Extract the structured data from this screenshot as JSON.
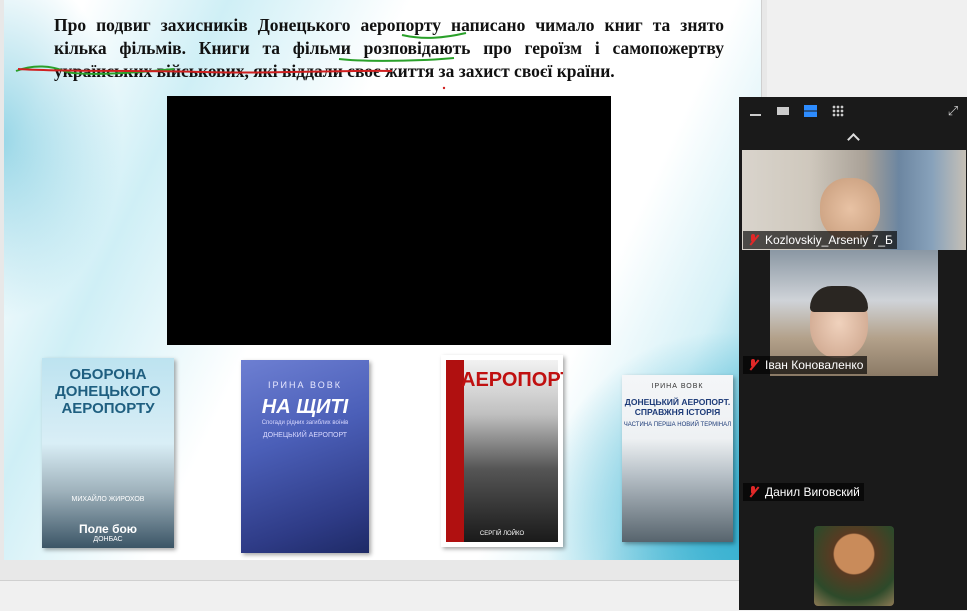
{
  "slide": {
    "text": "Про подвиг захисників Донецького аеропорту написано чимало книг та знято кілька фільмів. Книги та фільми розповідають про героїзм і самопожертву українських військових, які віддали своє життя за захист своєї країни.",
    "books": [
      {
        "title": "ОБОРОНА ДОНЕЦЬКОГО АЕРОПОРТУ",
        "author": "МИХАЙЛО ЖИРОХОВ",
        "subtitle": "Поле бою",
        "series": "ДОНБАС"
      },
      {
        "author": "ІРИНА ВОВК",
        "title": "НА ЩИТІ",
        "subtitle": "Спогади рідних загиблих воїнів",
        "series": "ДОНЕЦЬКИЙ АЕРОПОРТ"
      },
      {
        "title": "АЕРОПОРТ",
        "author": "СЕРГІЙ ЛОЙКО"
      },
      {
        "author": "ІРИНА ВОВК",
        "title": "ДОНЕЦЬКИЙ АЕРОПОРТ. СПРАВЖНЯ ІСТОРІЯ",
        "subtitle": "ЧАСТИНА ПЕРША НОВИЙ ТЕРМІНАЛ"
      }
    ]
  },
  "participants": [
    {
      "name": "Kozlovskiy_Arseniy 7_Б",
      "muted": true
    },
    {
      "name": "Іван Коноваленко",
      "muted": true
    },
    {
      "name": "Данил Виговский",
      "muted": true
    },
    {
      "name": "",
      "muted": false
    }
  ],
  "colors": {
    "accent": "#2d8cff",
    "muted_icon": "#e02828",
    "panel_bg": "#1a1a1a",
    "ink_green": "#2aa02a",
    "ink_red": "#d02020"
  }
}
